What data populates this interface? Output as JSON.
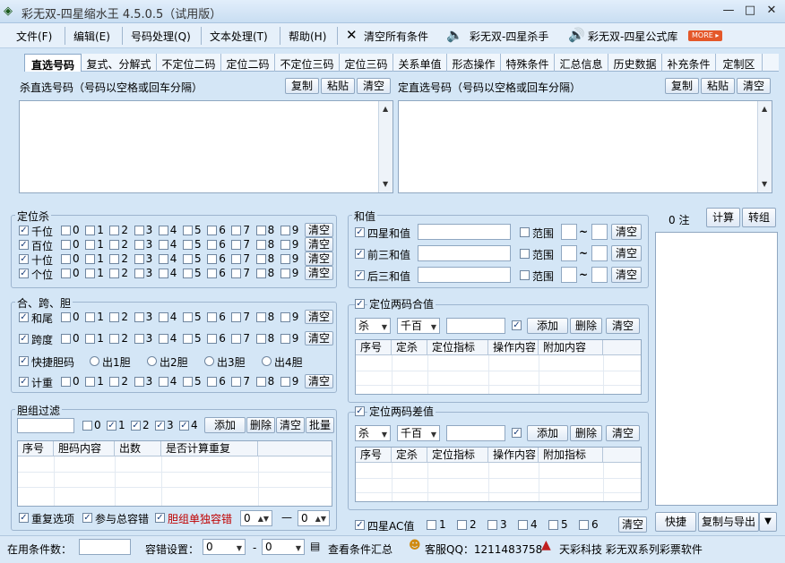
{
  "window": {
    "title": "彩无双-四星缩水王 4.5.0.5（试用版）",
    "min": "—",
    "max": "□",
    "close": "✕"
  },
  "menu": {
    "file": "文件(F)",
    "edit": "编辑(E)",
    "number": "号码处理(Q)",
    "text": "文本处理(T)",
    "help": "帮助(H)",
    "clear_all": "清空所有条件",
    "killer": "彩无双-四星杀手",
    "formula": "彩无双-四星公式库",
    "more": "MORE ▸"
  },
  "tabs": [
    "直选号码",
    "复式、分解式",
    "不定位二码",
    "定位二码",
    "不定位三码",
    "定位三码",
    "关系单值",
    "形态操作",
    "特殊条件",
    "汇总信息",
    "历史数据",
    "补充条件",
    "定制区"
  ],
  "kill_panel": {
    "label": "杀直选号码（号码以空格或回车分隔）",
    "copy": "复制",
    "paste": "粘贴",
    "clear": "清空"
  },
  "set_panel": {
    "label": "定直选号码（号码以空格或回车分隔）",
    "copy": "复制",
    "paste": "粘贴",
    "clear": "清空"
  },
  "position_kill": {
    "title": "定位杀",
    "rows": [
      "千位",
      "百位",
      "十位",
      "个位"
    ],
    "digits": [
      "0",
      "1",
      "2",
      "3",
      "4",
      "5",
      "6",
      "7",
      "8",
      "9"
    ],
    "clear": "清空"
  },
  "hkd": {
    "title": "合、跨、胆",
    "rows": [
      "和尾",
      "跨度"
    ],
    "quick": "快捷胆码",
    "options": [
      "出1胆",
      "出2胆",
      "出3胆",
      "出4胆"
    ],
    "count": "计重",
    "clear": "清空"
  },
  "dan": {
    "title": "胆组过滤",
    "nums": [
      "0",
      "1",
      "2",
      "3",
      "4"
    ],
    "add": "添加",
    "del": "删除",
    "clear": "清空",
    "batch": "批量",
    "cols": [
      "序号",
      "胆码内容",
      "出数",
      "是否计算重复"
    ],
    "repeat": "重复选项",
    "total": "参与总容错",
    "alone": "胆组单独容错",
    "v1": "0",
    "dash": "—",
    "v2": "0"
  },
  "sum": {
    "title": "和值",
    "rows": [
      "四星和值",
      "前三和值",
      "后三和值"
    ],
    "range": "范围",
    "tilde": "~",
    "clear": "清空"
  },
  "pos2sum": {
    "title": "定位两码合值",
    "kill": "杀",
    "pos": "千百",
    "add": "添加",
    "del": "删除",
    "clear": "清空",
    "cols": [
      "序号",
      "定杀",
      "定位指标",
      "操作内容",
      "附加内容"
    ]
  },
  "pos2diff": {
    "title": "定位两码差值",
    "kill": "杀",
    "pos": "千百",
    "add": "添加",
    "del": "删除",
    "clear": "清空",
    "cols": [
      "序号",
      "定杀",
      "定位指标",
      "操作内容",
      "附加指标"
    ]
  },
  "ac": {
    "title": "四星AC值",
    "vals": [
      "1",
      "2",
      "3",
      "4",
      "5",
      "6"
    ],
    "clear": "清空"
  },
  "result": {
    "count": "0 注",
    "calc": "计算",
    "convert": "转组",
    "quick": "快捷",
    "export": "复制与导出",
    "arrow": "▼"
  },
  "status": {
    "used": "在用条件数：",
    "tol": "容错设置：",
    "tol_a": "0",
    "dash": "-",
    "tol_b": "0",
    "summary": "查看条件汇总",
    "qq": "客服QQ：1211483758",
    "brand": "天彩科技 彩无双系列彩票软件"
  }
}
